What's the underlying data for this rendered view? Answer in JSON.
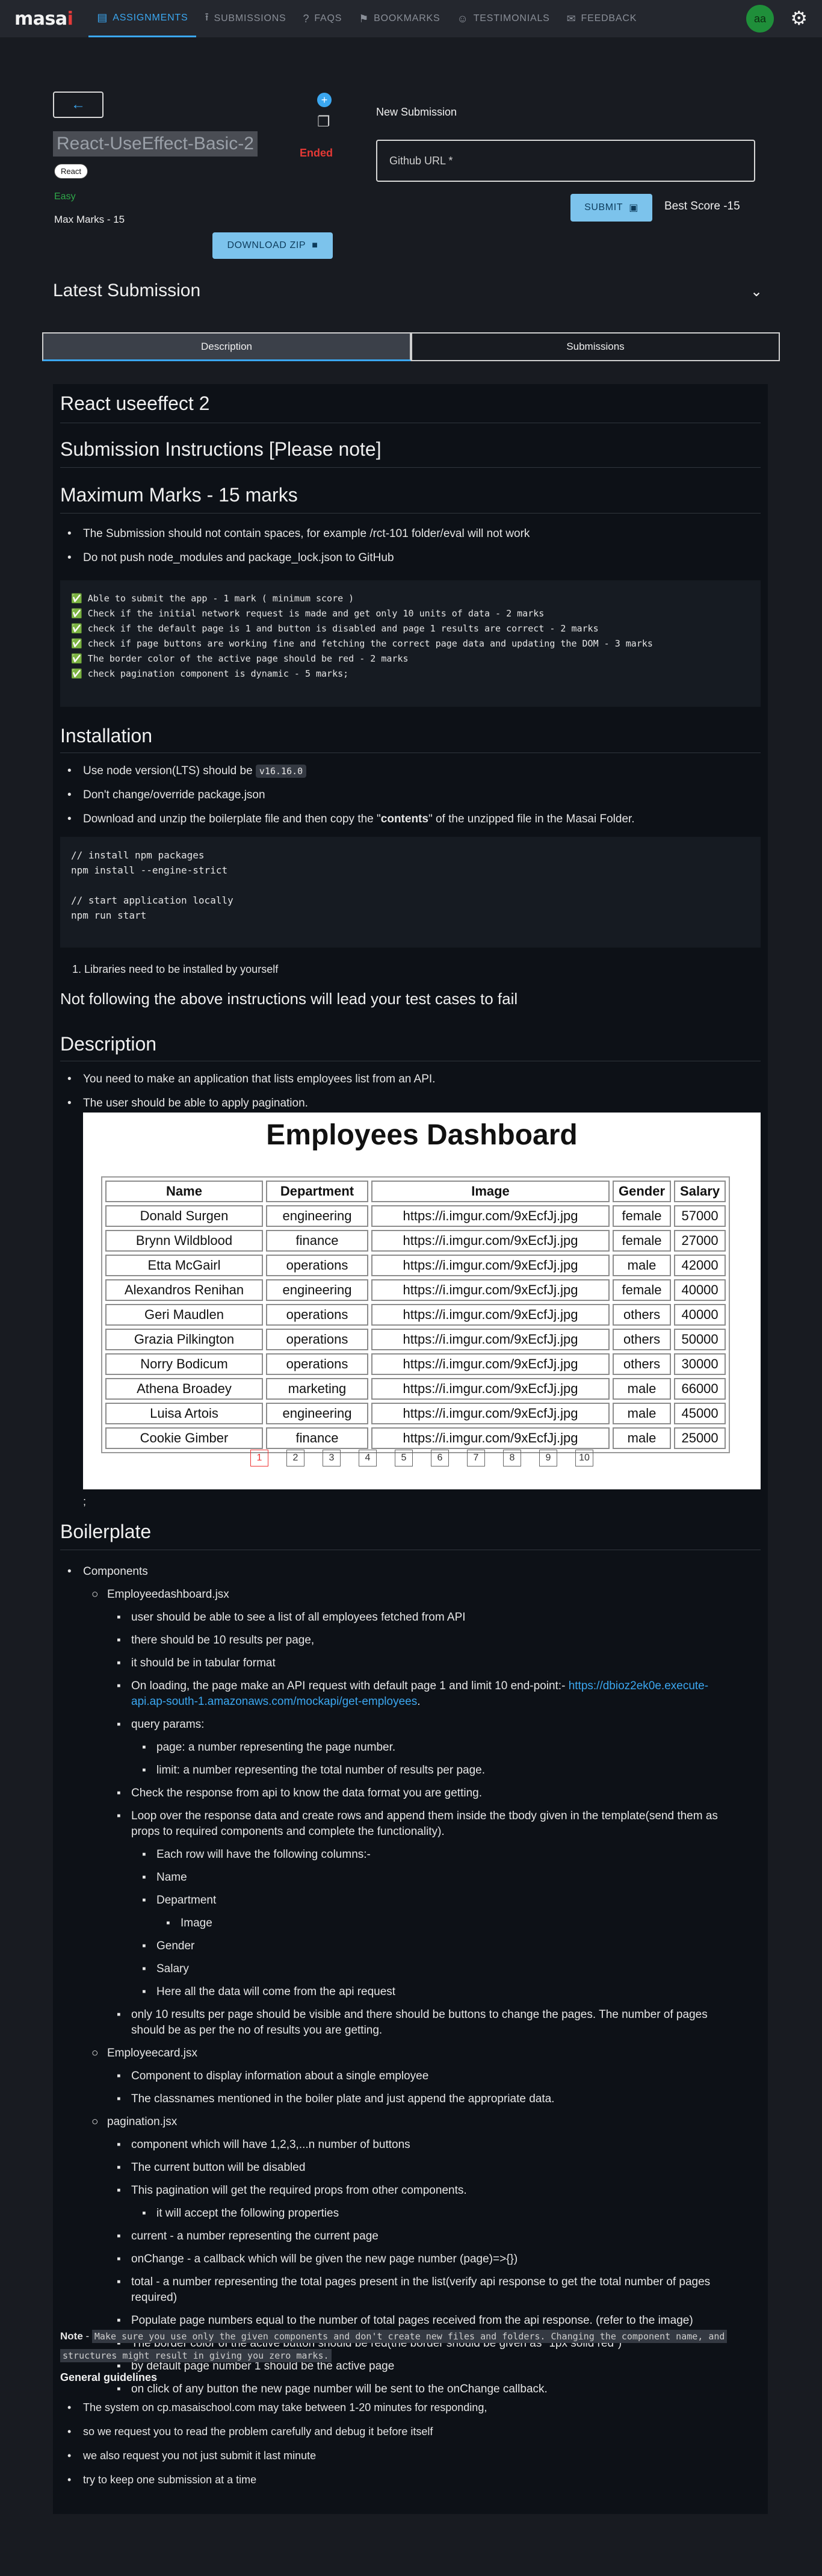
{
  "nav": {
    "logo_main": "masa",
    "logo_accent": "i",
    "items": [
      {
        "label": "ASSIGNMENTS",
        "icon": "assignment-icon",
        "glyph": "▤"
      },
      {
        "label": "SUBMISSIONS",
        "icon": "upload-icon",
        "glyph": "⭱"
      },
      {
        "label": "FAQS",
        "icon": "help-icon",
        "glyph": "?"
      },
      {
        "label": "BOOKMARKS",
        "icon": "bookmark-icon",
        "glyph": "⚑"
      },
      {
        "label": "TESTIMONIALS",
        "icon": "smile-icon",
        "glyph": "☺"
      },
      {
        "label": "FEEDBACK",
        "icon": "feedback-icon",
        "glyph": "✉"
      }
    ],
    "avatar": "aa"
  },
  "header": {
    "title": "React-UseEffect-Basic-2",
    "tag": "React",
    "difficulty": "Easy",
    "max_marks": "Max Marks - 15",
    "status": "Ended",
    "download_label": "DOWNLOAD ZIP",
    "new_submission": "New Submission",
    "url_placeholder": "Github URL *",
    "submit_label": "SUBMIT",
    "best_score": "Best Score -15"
  },
  "latest": {
    "title": "Latest Submission"
  },
  "tabs": {
    "description": "Description",
    "submissions": "Submissions"
  },
  "content": {
    "h_title": "React useeffect 2",
    "h_instructions": "Submission Instructions [Please note]",
    "h_max": "Maximum Marks - 15 marks",
    "rules": [
      "The Submission should not contain spaces, for example /rct-101 folder/eval will not work",
      "Do not push node_modules and package_lock.json to GitHub"
    ],
    "marks_code": "✅ Able to submit the app - 1 mark ( minimum score )\n✅ Check if the initial network request is made and get only 10 units of data - 2 marks\n✅ check if the default page is 1 and button is disabled and page 1 results are correct - 2 marks\n✅ check if page buttons are working fine and fetching the correct page data and updating the DOM - 3 marks\n✅ The border color of the active page should be red - 2 marks\n✅ check pagination component is dynamic - 5 marks;",
    "h_install": "Installation",
    "install_node_prefix": "Use node version(LTS) should be ",
    "install_node_version": "v16.16.0",
    "install_dont": "Don't change/override package.json",
    "install_download_a": "Download and unzip the boilerplate file and then copy the \"",
    "install_download_b": "contents",
    "install_download_c": "\" of the unzipped file in the Masai Folder.",
    "install_code": "// install npm packages\nnpm install --engine-strict\n\n// start application locally\nnpm run start",
    "libraries": "1. Libraries need to be installed by yourself",
    "h_warning": "Not following the above instructions will lead your test cases to fail",
    "h_description": "Description",
    "desc_items": [
      "You need to make an application that lists employees list from an API.",
      "The user should be able to apply pagination."
    ],
    "semicolon": ";",
    "h_boilerplate": "Boilerplate"
  },
  "dashboard": {
    "title": "Employees Dashboard",
    "columns": [
      "Name",
      "Department",
      "Image",
      "Gender",
      "Salary"
    ],
    "rows": [
      [
        "Donald Surgen",
        "engineering",
        "https://i.imgur.com/9xEcfJj.jpg",
        "female",
        "57000"
      ],
      [
        "Brynn Wildblood",
        "finance",
        "https://i.imgur.com/9xEcfJj.jpg",
        "female",
        "27000"
      ],
      [
        "Etta McGairl",
        "operations",
        "https://i.imgur.com/9xEcfJj.jpg",
        "male",
        "42000"
      ],
      [
        "Alexandros Renihan",
        "engineering",
        "https://i.imgur.com/9xEcfJj.jpg",
        "female",
        "40000"
      ],
      [
        "Geri Maudlen",
        "operations",
        "https://i.imgur.com/9xEcfJj.jpg",
        "others",
        "40000"
      ],
      [
        "Grazia Pilkington",
        "operations",
        "https://i.imgur.com/9xEcfJj.jpg",
        "others",
        "50000"
      ],
      [
        "Norry Bodicum",
        "operations",
        "https://i.imgur.com/9xEcfJj.jpg",
        "others",
        "30000"
      ],
      [
        "Athena Broadey",
        "marketing",
        "https://i.imgur.com/9xEcfJj.jpg",
        "male",
        "66000"
      ],
      [
        "Luisa Artois",
        "engineering",
        "https://i.imgur.com/9xEcfJj.jpg",
        "male",
        "45000"
      ],
      [
        "Cookie Gimber",
        "finance",
        "https://i.imgur.com/9xEcfJj.jpg",
        "male",
        "25000"
      ]
    ],
    "pages": [
      "1",
      "2",
      "3",
      "4",
      "5",
      "6",
      "7",
      "8",
      "9",
      "10"
    ],
    "active_page": "1"
  },
  "boilerplate": {
    "components": "Components",
    "emp_dash": "Employeedashboard.jsx",
    "b1": "user should be able to see a list of all employees fetched from API",
    "b2": "there should be 10 results per page,",
    "b3": "it should be in tabular format",
    "b4a": "On loading, the page make an API request with default page 1 and limit 10 end-point:- ",
    "b4link1": "https://dbioz2ek0e.execute-",
    "b4link2": "api.ap-south-1.amazonaws.com/mockapi/get-employees",
    "b4end": ".",
    "qp": "query params:",
    "qp1": "page: a number representing the page number.",
    "qp2": "limit: a number representing the total number of results per page.",
    "b5": "Check the response from api to know the data format you are getting.",
    "b6a": "Loop over the response data and create rows and append them inside the tbody given in the template(send them as",
    "b6b": "props to required components and complete the functionality).",
    "cols_intro": "Each row will have the following columns:-",
    "c_name": "Name",
    "c_dept": "Department",
    "c_image": "Image",
    "c_gender": "Gender",
    "c_salary": "Salary",
    "c_here": "Here all the data will come from the api request",
    "b7a": "only 10 results per page should be visible and there should be buttons to change the pages. The number of pages",
    "b7b": "should be as per the no of results you are getting.",
    "emp_card": "Employeecard.jsx",
    "ec1": "Component to display information about a single employee",
    "ec2": "The classnames mentioned in the boiler plate and just append the appropriate data.",
    "pag": "pagination.jsx",
    "p1": "component which will have 1,2,3,...n number of buttons",
    "p2": "The current button will be disabled",
    "p3": "This pagination will get the required props from other components.",
    "p3a": "it will accept the following properties",
    "p4": "current - a number representing the current page",
    "p5": "onChange - a callback which will be given the new page number (page)=>{})",
    "p6a": "total - a number representing the total pages present in the list(verify api response to get the total number of pages",
    "p6b": "required)",
    "p7": "Populate page numbers equal to the number of total pages received from the api response. (refer to the image)",
    "p8": "The border color of the active button should be red(the border should be given as \"1px solid red\")",
    "p9": "by default page number 1 should be the active page",
    "p10": "on click of any button the new page number will be sent to the onChange callback."
  },
  "note": {
    "label": "Note",
    "dash": " - ",
    "code1": "Make sure you use only the given components and don't create new files and folders. Changing the component name, and",
    "code2": "structures might result in giving you zero marks.",
    "guidelines_title": "General guidelines",
    "guidelines": [
      "The system on cp.masaischool.com may take between 1-20 minutes for responding,",
      "so we request you to read the problem carefully and debug it before itself",
      "we also request you not just submit it last minute",
      "try to keep one submission at a time"
    ]
  }
}
